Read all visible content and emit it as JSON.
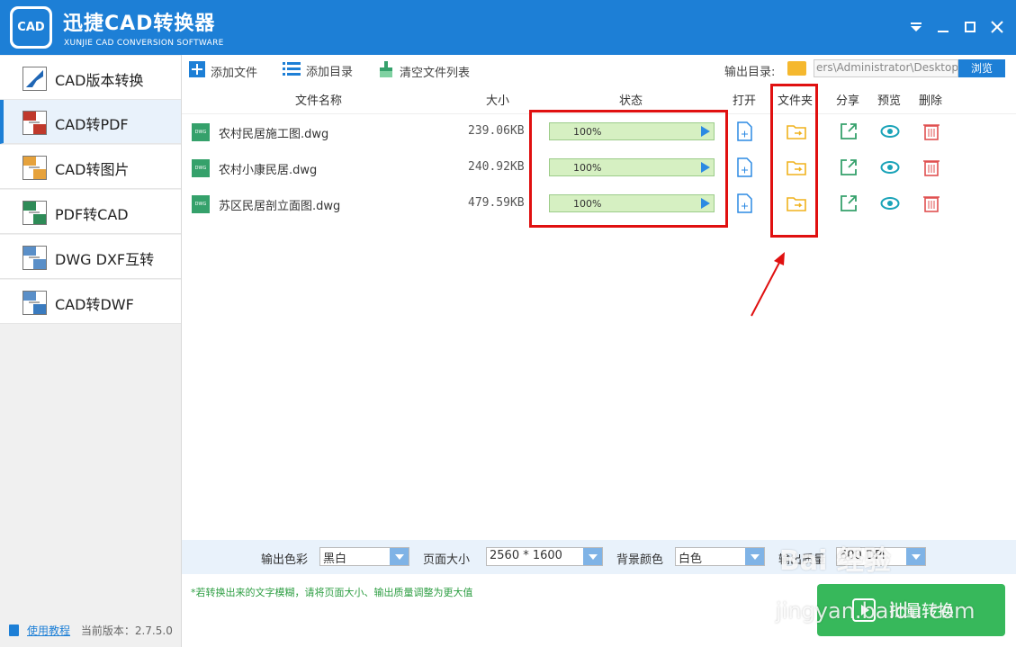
{
  "app": {
    "logo_text": "CAD",
    "title": "迅捷CAD转换器",
    "subtitle": "XUNJIE CAD CONVERSION SOFTWARE"
  },
  "sidebar": {
    "items": [
      {
        "label": "CAD版本转换",
        "icon": "cad-version-icon"
      },
      {
        "label": "CAD转PDF",
        "icon": "cad-to-pdf-icon",
        "active": true
      },
      {
        "label": "CAD转图片",
        "icon": "cad-to-image-icon"
      },
      {
        "label": "PDF转CAD",
        "icon": "pdf-to-cad-icon"
      },
      {
        "label": "DWG DXF互转",
        "icon": "dwg-dxf-icon"
      },
      {
        "label": "CAD转DWF",
        "icon": "cad-to-dwf-icon"
      }
    ],
    "footer": {
      "tutorial": "使用教程",
      "version": "当前版本：2.7.5.0"
    }
  },
  "toolbar": {
    "add_file": "添加文件",
    "add_dir": "添加目录",
    "clear_list": "清空文件列表",
    "output_label": "输出目录:",
    "output_path": "ers\\Administrator\\Desktop",
    "browse": "浏览"
  },
  "table": {
    "headers": {
      "name": "文件名称",
      "size": "大小",
      "status": "状态",
      "open": "打开",
      "folder": "文件夹",
      "share": "分享",
      "preview": "预览",
      "delete": "删除"
    },
    "rows": [
      {
        "name": "农村民居施工图.dwg",
        "size": "239.06KB",
        "progress": 100,
        "progress_text": "100%"
      },
      {
        "name": "农村小康民居.dwg",
        "size": "240.92KB",
        "progress": 100,
        "progress_text": "100%"
      },
      {
        "name": "苏区民居剖立面图.dwg",
        "size": "479.59KB",
        "progress": 100,
        "progress_text": "100%"
      }
    ]
  },
  "options": {
    "color_label": "输出色彩",
    "color_value": "黑白",
    "page_label": "页面大小",
    "page_value": "2560 * 1600",
    "bg_label": "背景颜色",
    "bg_value": "白色",
    "quality_label": "输出质量",
    "quality_value": "600 DPI"
  },
  "hint": "*若转换出来的文字模糊，请将页面大小、输出质量调整为更大值",
  "convert_button": "批量转换",
  "watermark": {
    "line1": "Bai 经验",
    "line2": "jingyan.baidu.com"
  },
  "colors": {
    "accent": "#1d7fd6",
    "highlight": "#e01010",
    "success": "#37b85b",
    "folder": "#f5b82e"
  }
}
